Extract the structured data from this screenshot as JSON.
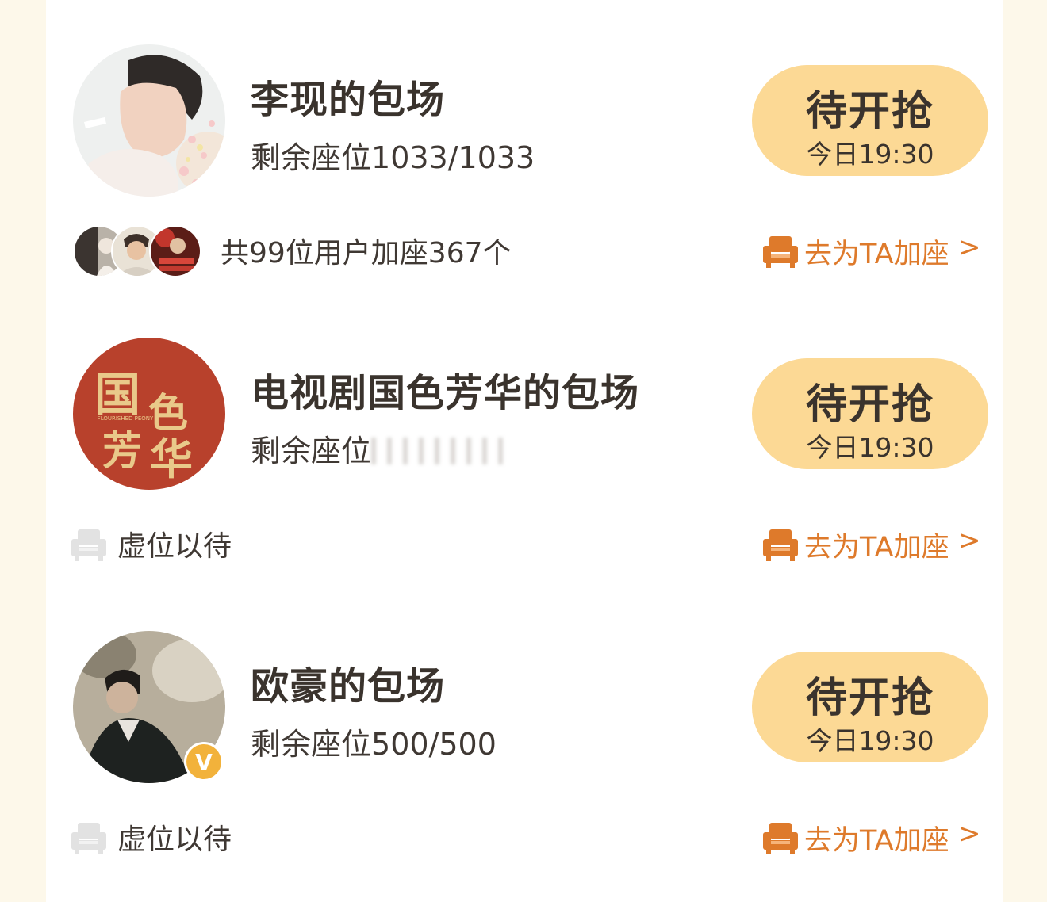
{
  "colors": {
    "page_bg": "#fdf8ea",
    "card_bg": "#ffffff",
    "button_bg": "#fcd995",
    "accent": "#de7a2b",
    "text": "#3a332d"
  },
  "entries": [
    {
      "title": "李现的包场",
      "seats_label": "剩余座位",
      "seats_value": "1033/1033",
      "button_main": "待开抢",
      "button_time": "今日19:30",
      "participants_text": "共99位用户加座367个",
      "add_seat_label": "去为TA加座",
      "chevron": ">"
    },
    {
      "title": "电视剧国色芳华的包场",
      "seats_label": "剩余座位",
      "seats_value": "",
      "seats_value_obscured": true,
      "avatar_logo_text": "国色芳华",
      "avatar_logo_sub": "FLOURISHED PEONY",
      "button_main": "待开抢",
      "button_time": "今日19:30",
      "waiting_text": "虚位以待",
      "add_seat_label": "去为TA加座",
      "chevron": ">"
    },
    {
      "title": "欧豪的包场",
      "seats_label": "剩余座位",
      "seats_value": "500/500",
      "verified_badge": "V",
      "button_main": "待开抢",
      "button_time": "今日19:30",
      "waiting_text": "虚位以待",
      "add_seat_label": "去为TA加座",
      "chevron": ">"
    }
  ]
}
